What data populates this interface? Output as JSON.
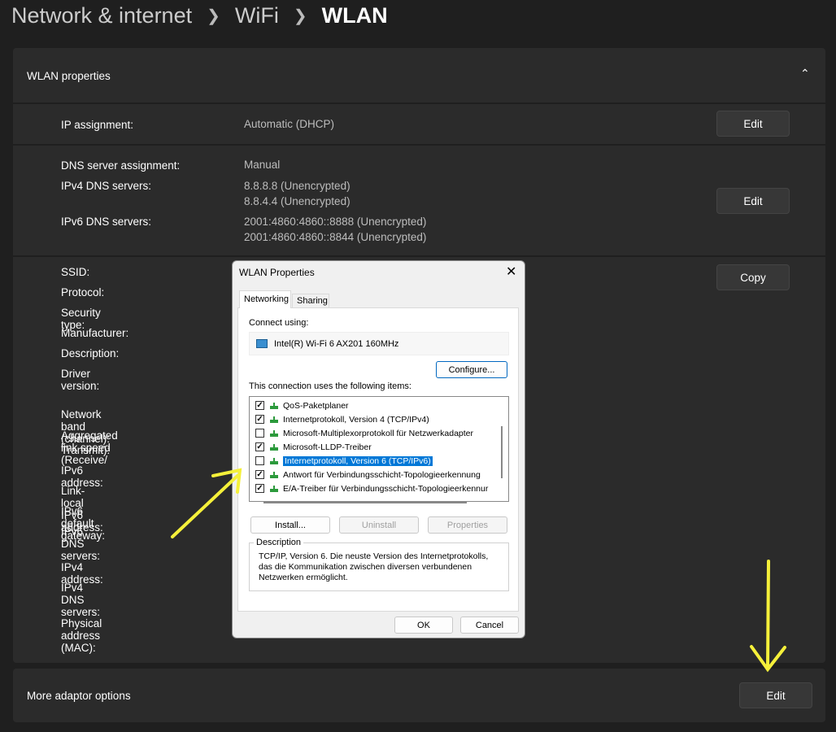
{
  "breadcrumb": [
    "Network & internet",
    "WiFi",
    "WLAN"
  ],
  "section": {
    "title": "WLAN properties"
  },
  "ip": {
    "label": "IP assignment:",
    "value": "Automatic (DHCP)",
    "button": "Edit"
  },
  "dns": {
    "assign_label": "DNS server assignment:",
    "assign_value": "Manual",
    "ipv4_label": "IPv4 DNS servers:",
    "ipv4_values": [
      "8.8.8.8 (Unencrypted)",
      "8.8.4.4 (Unencrypted)"
    ],
    "ipv6_label": "IPv6 DNS servers:",
    "ipv6_values": [
      "2001:4860:4860::8888 (Unencrypted)",
      "2001:4860:4860::8844 (Unencrypted)"
    ],
    "button": "Edit"
  },
  "props": {
    "labels": [
      "SSID:",
      "Protocol:",
      "Security type:",
      "Manufacturer:",
      "Description:",
      "Driver version:",
      "Network band (channel):",
      "Aggregated link speed (Receive/",
      "Transmit):",
      "IPv6 address:",
      "Link-local IPv6 address:",
      "IPv6 default gateway:",
      "IPv6 DNS servers:",
      "IPv4 address:",
      "IPv4 DNS servers:",
      "Physical address (MAC):"
    ],
    "button": "Copy"
  },
  "more": {
    "label": "More adaptor options",
    "button": "Edit"
  },
  "dialog": {
    "title": "WLAN Properties",
    "tabs": [
      "Networking",
      "Sharing"
    ],
    "connect_using": "Connect using:",
    "adapter": "Intel(R) Wi-Fi 6 AX201 160MHz",
    "configure": "Configure...",
    "items_label": "This connection uses the following items:",
    "items": [
      {
        "label": "QoS-Paketplaner",
        "checked": true
      },
      {
        "label": "Internetprotokoll, Version 4 (TCP/IPv4)",
        "checked": true
      },
      {
        "label": "Microsoft-Multiplexorprotokoll für Netzwerkadapter",
        "checked": false
      },
      {
        "label": "Microsoft-LLDP-Treiber",
        "checked": true
      },
      {
        "label": "Internetprotokoll, Version 6 (TCP/IPv6)",
        "checked": false,
        "selected": true
      },
      {
        "label": "Antwort für Verbindungsschicht-Topologieerkennung",
        "checked": true
      },
      {
        "label": "E/A-Treiber für Verbindungsschicht-Topologieerkennur",
        "checked": true
      }
    ],
    "install": "Install...",
    "uninstall": "Uninstall",
    "properties": "Properties",
    "description_label": "Description",
    "description": "TCP/IP, Version 6. Die neuste Version des Internetprotokolls, das die Kommunikation zwischen diversen verbundenen Netzwerken ermöglicht.",
    "ok": "OK",
    "cancel": "Cancel"
  },
  "annotation_color": "#f5f03a"
}
